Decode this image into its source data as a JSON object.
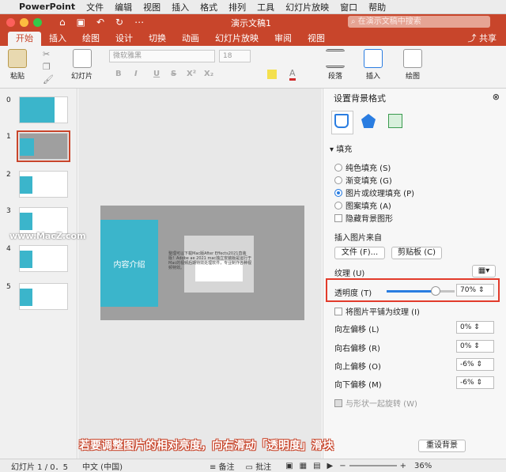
{
  "menubar": {
    "apple": "",
    "app": "PowerPoint",
    "items": [
      "文件",
      "编辑",
      "视图",
      "插入",
      "格式",
      "排列",
      "工具",
      "幻灯片放映",
      "窗口",
      "帮助"
    ]
  },
  "titlebar": {
    "doc_title": "演示文稿1",
    "search_placeholder": "在演示文稿中搜索"
  },
  "ribbon_tabs": [
    "开始",
    "插入",
    "绘图",
    "设计",
    "切换",
    "动画",
    "幻灯片放映",
    "审阅",
    "视图"
  ],
  "share_label": "共享",
  "ribbon": {
    "paste": "粘贴",
    "slides": "幻灯片",
    "font_name": "微软雅黑",
    "font_size": "18",
    "paragraph": "段落",
    "insert": "插入",
    "draw": "绘图",
    "format_glyphs": [
      "B",
      "I",
      "U",
      "S",
      "X²",
      "X₂"
    ]
  },
  "thumbnails": {
    "numbers": [
      "0",
      "1",
      "2",
      "3",
      "4",
      "5"
    ]
  },
  "slide": {
    "title": "内容介绍",
    "body": "整理可以下载Mac版After Effects2021直装版！Adobe ae 2021 mac独立安装版是运行于Mac的视频后期特效处理软件，专业制作各种视频特效。"
  },
  "watermark": "www.MacZ.com",
  "pane": {
    "title": "设置背景格式",
    "section": "填充",
    "fill_options": [
      "纯色填充 (S)",
      "渐变填充 (G)",
      "图片或纹理填充 (P)",
      "图案填充 (A)"
    ],
    "hide_bg": "隐藏背景图形",
    "insert_from": "插入图片来自",
    "file_btn": "文件 (F)...",
    "clipboard_btn": "剪贴板 (C)",
    "texture": "纹理 (U)",
    "transparency": "透明度 (T)",
    "transparency_value": "70%",
    "transparency_level": 0.7,
    "tile": "将图片平铺为纹理 (I)",
    "offsets": [
      {
        "label": "向左偏移 (L)",
        "value": "0%"
      },
      {
        "label": "向右偏移 (R)",
        "value": "0%"
      },
      {
        "label": "向上偏移 (O)",
        "value": "-6%"
      },
      {
        "label": "向下偏移 (M)",
        "value": "-6%"
      }
    ],
    "rotate": "与形状一起旋转 (W)",
    "reset_btn": "重设背景"
  },
  "caption": "若要调整图片的相对亮度，向右滑动「透明度」滑块",
  "status": {
    "slide_info": "幻灯片 1 / 0．5",
    "language": "中文 (中国)",
    "notes": "备注",
    "comments": "批注",
    "zoom": "36%"
  }
}
